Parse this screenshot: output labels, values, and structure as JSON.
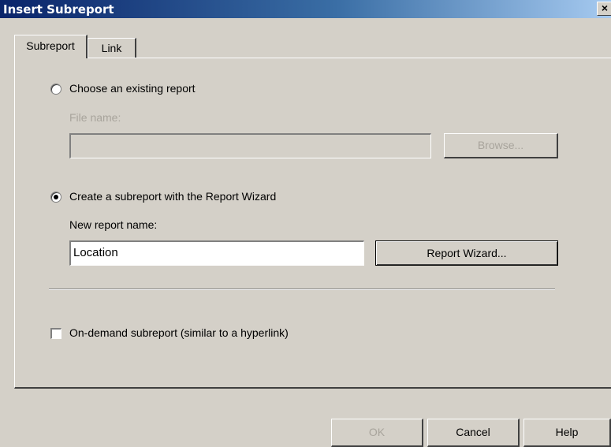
{
  "window": {
    "title": "Insert Subreport",
    "close_glyph": "×"
  },
  "tabs": [
    {
      "label": "Subreport",
      "active": true
    },
    {
      "label": "Link",
      "active": false
    }
  ],
  "existing": {
    "radio_label": "Choose an existing report",
    "file_label": "File name:",
    "file_value": "",
    "browse_label": "Browse..."
  },
  "wizard": {
    "radio_label": "Create a subreport with the Report Wizard",
    "name_label": "New report name:",
    "name_value": "Location",
    "wizard_button": "Report Wizard..."
  },
  "on_demand": {
    "label": "On-demand subreport (similar to a hyperlink)",
    "checked": false
  },
  "footer": {
    "ok": "OK",
    "cancel": "Cancel",
    "help": "Help"
  }
}
